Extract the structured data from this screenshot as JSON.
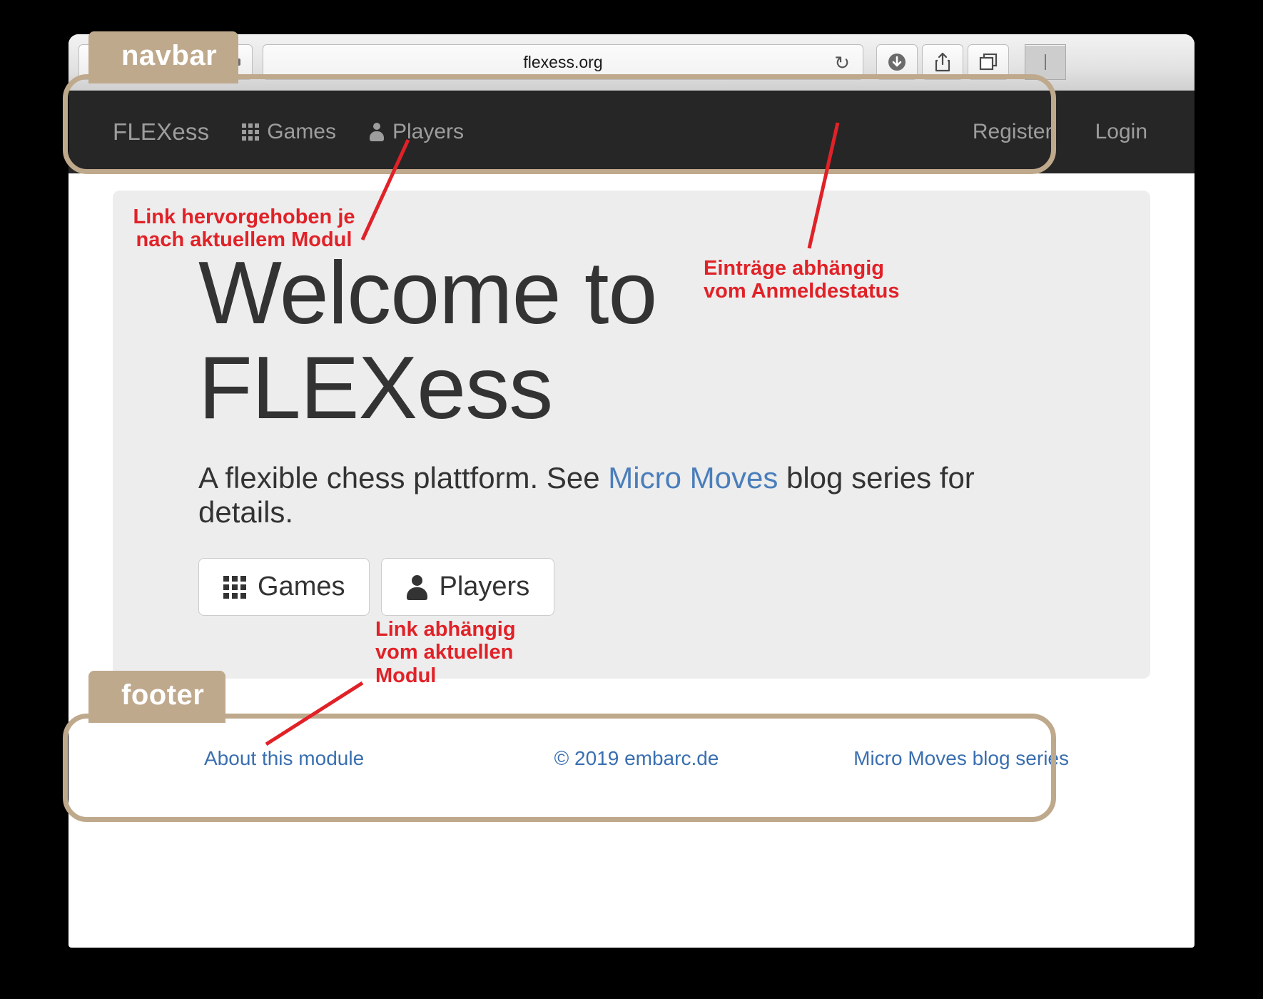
{
  "browser": {
    "url": "flexess.org",
    "reload_icon": "reload-icon",
    "buttons": [
      {
        "name": "back-button",
        "icon": "chevron-left-icon"
      },
      {
        "name": "forward-button",
        "icon": "chevron-right-icon"
      },
      {
        "name": "sidebar-button",
        "icon": "sidebar-icon"
      },
      {
        "name": "print-button",
        "icon": "printer-icon"
      },
      {
        "name": "download-button",
        "icon": "download-icon"
      },
      {
        "name": "share-button",
        "icon": "share-icon"
      },
      {
        "name": "tabs-button",
        "icon": "tabs-icon"
      },
      {
        "name": "more-button",
        "icon": "more-icon"
      }
    ]
  },
  "navbar": {
    "brand": "FLEXess",
    "links": [
      {
        "label": "Games",
        "icon": "grid-icon"
      },
      {
        "label": "Players",
        "icon": "person-icon"
      }
    ],
    "account": [
      {
        "label": "Register"
      },
      {
        "label": "Login"
      }
    ]
  },
  "hero": {
    "title_line1": "Welcome to",
    "title_line2": "FLEXess",
    "sub_before": "A flexible chess plattform. See ",
    "sub_link": "Micro Moves",
    "sub_after": " blog series for details.",
    "buttons": [
      {
        "label": "Games",
        "icon": "grid-icon"
      },
      {
        "label": "Players",
        "icon": "person-icon"
      }
    ]
  },
  "footer": {
    "left_link": "About this module",
    "copyright": "© 2019 embarc.de",
    "right_link": "Micro Moves blog series"
  },
  "annotations": {
    "tag_navbar": "navbar",
    "tag_footer": "footer",
    "note_nav_left": "Link hervorgehoben je nach aktuellem Modul",
    "note_nav_left_l1": "Link hervorgehoben je",
    "note_nav_left_l2": "nach aktuellem Modul",
    "note_nav_right_l1": "Einträge abhängig",
    "note_nav_right_l2": "vom Anmeldestatus",
    "note_footer_l1": "Link abhängig",
    "note_footer_l2": "vom aktuellen",
    "note_footer_l3": "Modul"
  },
  "colors": {
    "callout": "#bfa98c",
    "annotation": "#e02228",
    "navbar_bg": "#262626",
    "jumbotron_bg": "#ededed",
    "link_blue": "#4a7ebb"
  }
}
